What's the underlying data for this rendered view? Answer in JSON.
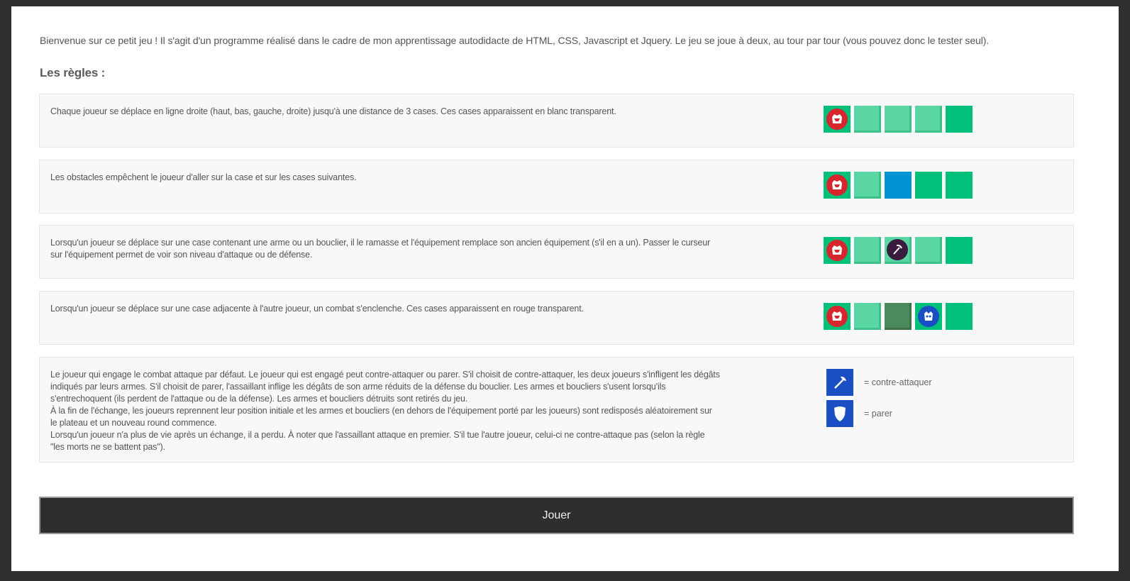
{
  "intro": "Bienvenue sur ce petit jeu ! Il s'agit d'un programme réalisé dans le cadre de mon apprentissage autodidacte de HTML, CSS, Javascript et Jquery. Le jeu se joue à deux, au tour par tour (vous pouvez donc le tester seul).",
  "rules_title": "Les règles :",
  "rules": [
    {
      "text": "Chaque joueur se déplace en ligne droite (haut, bas, gauche, droite) jusqu'à une distance de 3 cases. Ces cases apparaissent en blanc transparent.",
      "tiles": [
        "player-red",
        "reachable",
        "reachable",
        "reachable",
        "grass"
      ]
    },
    {
      "text": "Les obstacles empêchent le joueur d'aller sur la case et sur les cases suivantes.",
      "tiles": [
        "player-red",
        "reachable",
        "obstacle",
        "grass",
        "grass"
      ]
    },
    {
      "text": "Lorsqu'un joueur se déplace sur une case contenant une arme ou un bouclier, il le ramasse et l'équipement remplace son ancien équipement (s'il en a un). Passer le curseur sur l'équipement permet de voir son niveau d'attaque ou de défense.",
      "tiles": [
        "player-red",
        "reachable",
        "weapon",
        "reachable",
        "grass"
      ]
    },
    {
      "text": "Lorsqu'un joueur se déplace sur une case adjacente à l'autre joueur, un combat s'enclenche. Ces cases apparaissent en rouge transparent.",
      "tiles": [
        "player-red",
        "reachable",
        "combat",
        "player-blue",
        "grass"
      ]
    }
  ],
  "combat_rule": {
    "lines": [
      "Le joueur qui engage le combat attaque par défaut. Le joueur qui est engagé peut contre-attaquer ou parer. S'il choisit de contre-attaquer, les deux joueurs s'infligent les dégâts indiqués par leurs armes. S'il choisit de parer, l'assaillant inflige les dégâts de son arme réduits de la défense du bouclier. Les armes et boucliers s'usent lorsqu'ils s'entrechoquent (ils perdent de l'attaque ou de la défense). Les armes et boucliers détruits sont retirés du jeu.",
      "À la fin de l'échange, les joueurs reprennent leur position initiale et les armes et boucliers (en dehors de l'équipement porté par les joueurs) sont redisposés aléatoirement sur le plateau et un nouveau round commence.",
      "Lorsqu'un joueur n'a plus de vie après un échange, il a perdu. À noter que l'assaillant attaque en premier. S'il tue l'autre joueur, celui-ci ne contre-attaque pas (selon la règle \"les morts ne se battent pas\")."
    ],
    "legend": [
      {
        "icon": "axe-icon",
        "label": "= contre-attaquer"
      },
      {
        "icon": "shield-icon",
        "label": "= parer"
      }
    ]
  },
  "play_button": "Jouer",
  "colors": {
    "grass": "#00c07a",
    "reachable": "#5ad6a4",
    "obstacle": "#0094d4",
    "combat": "#4b8a5c",
    "player_red": "#d8262f",
    "player_blue": "#1a4fc4",
    "weapon_bg": "#3a1c3e",
    "legend_bg": "#1a4fc4"
  }
}
